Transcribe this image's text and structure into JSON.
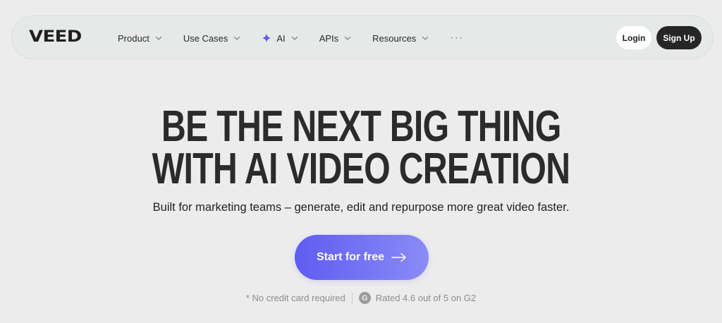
{
  "brand": {
    "logo_text": "VEED"
  },
  "nav": {
    "items": [
      {
        "label": "Product",
        "icon": "chevron-down-icon"
      },
      {
        "label": "Use Cases",
        "icon": "chevron-down-icon"
      },
      {
        "label": "AI",
        "icon": "sparkle-icon"
      },
      {
        "label": "APIs",
        "icon": "chevron-down-icon"
      },
      {
        "label": "Resources",
        "icon": "chevron-down-icon"
      }
    ],
    "more_label": "···",
    "login_label": "Login",
    "signup_label": "Sign Up"
  },
  "hero": {
    "title_line1": "BE THE NEXT BIG THING",
    "title_line2": "WITH AI VIDEO CREATION",
    "subtitle": "Built for marketing teams – generate, edit and repurpose more great video faster.",
    "cta_label": "Start for free",
    "cta_icon": "arrow-right-icon"
  },
  "footnote": {
    "no_card": "* No credit card required",
    "g2_icon_text": "G",
    "rating": "Rated 4.6 out of 5 on G2"
  },
  "colors": {
    "background": "#ececed",
    "accent_start": "#5f5cf2",
    "accent_end": "#8b8bf7",
    "sparkle": "#5b55f0",
    "dark_button": "#262626"
  }
}
